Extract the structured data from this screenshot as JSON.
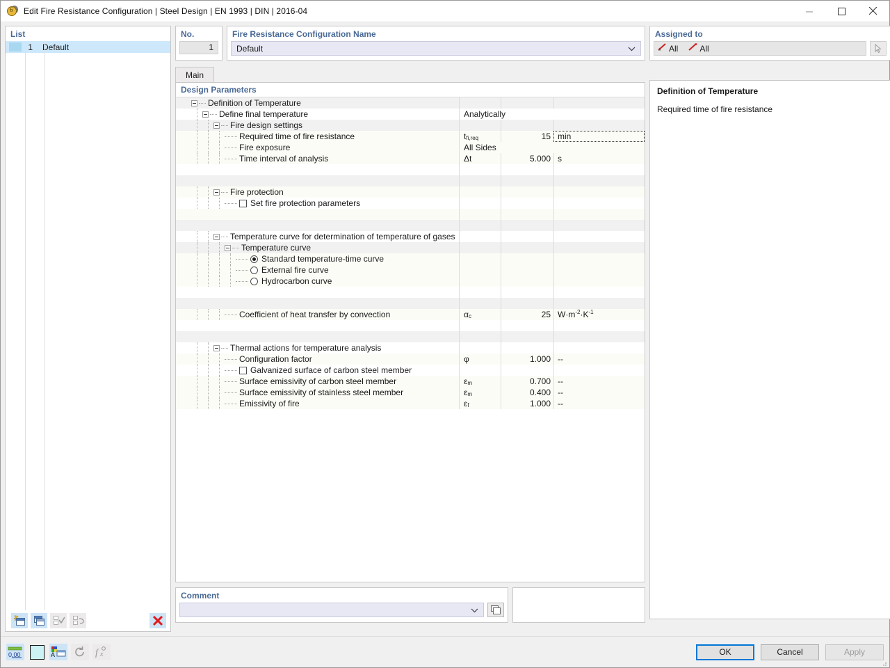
{
  "window": {
    "title": "Edit Fire Resistance Configuration | Steel Design | EN 1993 | DIN | 2016-04",
    "minimize_label": "Minimize",
    "maximize_label": "Maximize",
    "close_label": "Close"
  },
  "list_panel": {
    "title": "List",
    "rows": [
      {
        "no": "1",
        "name": "Default"
      }
    ],
    "toolbar": [
      {
        "name": "new-configuration-button",
        "label": "New"
      },
      {
        "name": "copy-configuration-button",
        "label": "Copy"
      },
      {
        "name": "select-all-button",
        "label": "Select All"
      },
      {
        "name": "deselect-button",
        "label": "Deselect"
      },
      {
        "name": "delete-configuration-button",
        "label": "Delete"
      }
    ]
  },
  "header": {
    "no_label": "No.",
    "no_value": "1",
    "name_label": "Fire Resistance Configuration Name",
    "name_value": "Default",
    "assigned_label": "Assigned to",
    "assigned_items": [
      "All",
      "All"
    ]
  },
  "tabs": [
    {
      "label": "Main",
      "active": true
    }
  ],
  "tree": {
    "section_title": "Design Parameters",
    "rows": [
      {
        "id": "definition-of-temperature",
        "kind": "group",
        "depth": 0,
        "label": "Definition of Temperature",
        "expander": true,
        "value": "",
        "symbol": "",
        "unit": "",
        "stripe": "grey"
      },
      {
        "id": "define-final-temperature",
        "kind": "group",
        "depth": 1,
        "label": "Define final temperature",
        "expander": true,
        "symbol": "",
        "value": "",
        "unit": "",
        "wide_value": "Analytically",
        "stripe": "a"
      },
      {
        "id": "fire-design-settings",
        "kind": "group",
        "depth": 2,
        "label": "Fire design settings",
        "expander": true,
        "symbol": "",
        "value": "",
        "unit": "",
        "stripe": "grey"
      },
      {
        "id": "required-time-of-fire-resistance",
        "kind": "field",
        "depth": 3,
        "label": "Required time of fire resistance",
        "symbol": "tfi,req",
        "value": "15",
        "unit": "min",
        "unit_focused": true,
        "stripe": "b"
      },
      {
        "id": "fire-exposure",
        "kind": "field",
        "depth": 3,
        "label": "Fire exposure",
        "symbol": "",
        "value": "",
        "unit": "",
        "wide_value": "All Sides",
        "stripe": "b"
      },
      {
        "id": "time-interval-of-analysis",
        "kind": "field",
        "depth": 3,
        "label": "Time interval of analysis",
        "symbol": "Δt",
        "value": "5.000",
        "unit": "s",
        "stripe": "b"
      },
      {
        "id": "spacer-1",
        "kind": "spacer",
        "depth": 0,
        "label": "",
        "stripe": "a"
      },
      {
        "id": "spacer-2",
        "kind": "spacer",
        "depth": 0,
        "label": "",
        "stripe": "grey"
      },
      {
        "id": "fire-protection",
        "kind": "group",
        "depth": 2,
        "label": "Fire protection",
        "expander": true,
        "symbol": "",
        "value": "",
        "unit": "",
        "stripe": "b"
      },
      {
        "id": "set-fire-protection-parameters",
        "kind": "checkbox",
        "depth": 3,
        "label": "Set fire protection parameters",
        "checked": false,
        "symbol": "",
        "value": "",
        "unit": "",
        "stripe": "a"
      },
      {
        "id": "spacer-3",
        "kind": "spacer",
        "depth": 0,
        "label": "",
        "stripe": "b"
      },
      {
        "id": "spacer-4",
        "kind": "spacer",
        "depth": 0,
        "label": "",
        "stripe": "grey"
      },
      {
        "id": "temperature-curve-for-gases",
        "kind": "group",
        "depth": 2,
        "label": "Temperature curve for determination of temperature of gases",
        "expander": true,
        "symbol": "",
        "value": "",
        "unit": "",
        "stripe": "a"
      },
      {
        "id": "temperature-curve",
        "kind": "group",
        "depth": 3,
        "label": "Temperature curve",
        "expander": true,
        "symbol": "",
        "value": "",
        "unit": "",
        "stripe": "grey"
      },
      {
        "id": "standard-temperature-time-curve",
        "kind": "radio",
        "depth": 4,
        "label": "Standard temperature-time curve",
        "checked": true,
        "symbol": "",
        "value": "",
        "unit": "",
        "stripe": "b"
      },
      {
        "id": "external-fire-curve",
        "kind": "radio",
        "depth": 4,
        "label": "External fire curve",
        "checked": false,
        "symbol": "",
        "value": "",
        "unit": "",
        "stripe": "b"
      },
      {
        "id": "hydrocarbon-curve",
        "kind": "radio",
        "depth": 4,
        "label": "Hydrocarbon curve",
        "checked": false,
        "symbol": "",
        "value": "",
        "unit": "",
        "stripe": "b"
      },
      {
        "id": "spacer-5",
        "kind": "spacer",
        "depth": 0,
        "label": "",
        "stripe": "a"
      },
      {
        "id": "spacer-6",
        "kind": "spacer",
        "depth": 0,
        "label": "",
        "stripe": "grey"
      },
      {
        "id": "coefficient-of-heat-transfer-by-convection",
        "kind": "field",
        "depth": 3,
        "label": "Coefficient of heat transfer by convection",
        "symbol": "αc",
        "value": "25",
        "unit": "W·m-2·K-1",
        "stripe": "b"
      },
      {
        "id": "spacer-7",
        "kind": "spacer",
        "depth": 0,
        "label": "",
        "stripe": "a"
      },
      {
        "id": "spacer-8",
        "kind": "spacer",
        "depth": 0,
        "label": "",
        "stripe": "grey"
      },
      {
        "id": "thermal-actions-for-temperature-analysis",
        "kind": "group",
        "depth": 2,
        "label": "Thermal actions for temperature analysis",
        "expander": true,
        "symbol": "",
        "value": "",
        "unit": "",
        "stripe": "a"
      },
      {
        "id": "configuration-factor",
        "kind": "field",
        "depth": 3,
        "label": "Configuration factor",
        "symbol": "φ",
        "value": "1.000",
        "unit": "--",
        "stripe": "b"
      },
      {
        "id": "galvanized-surface-of-carbon-steel-member",
        "kind": "checkbox",
        "depth": 3,
        "label": "Galvanized surface of carbon steel member",
        "checked": false,
        "symbol": "",
        "value": "",
        "unit": "",
        "stripe": "a"
      },
      {
        "id": "surface-emissivity-of-carbon-steel-member",
        "kind": "field",
        "depth": 3,
        "label": "Surface emissivity of carbon steel member",
        "symbol": "εm",
        "value": "0.700",
        "unit": "--",
        "stripe": "b"
      },
      {
        "id": "surface-emissivity-of-stainless-steel-member",
        "kind": "field",
        "depth": 3,
        "label": "Surface emissivity of stainless steel member",
        "symbol": "εm",
        "value": "0.400",
        "unit": "--",
        "stripe": "b"
      },
      {
        "id": "emissivity-of-fire",
        "kind": "field",
        "depth": 3,
        "label": "Emissivity of fire",
        "symbol": "εf",
        "value": "1.000",
        "unit": "--",
        "stripe": "b"
      }
    ]
  },
  "comment": {
    "label": "Comment",
    "value": "",
    "placeholder": ""
  },
  "info_panel": {
    "title": "Definition of Temperature",
    "text": "Required time of fire resistance"
  },
  "status_bar": {
    "buttons": [
      {
        "name": "decimal-places-button",
        "label": "0.00"
      },
      {
        "name": "color-swatch-button",
        "label": "Color"
      },
      {
        "name": "display-properties-button",
        "label": "Display Properties"
      },
      {
        "name": "reset-button",
        "label": "Reset"
      },
      {
        "name": "formula-button",
        "label": "Formula"
      }
    ]
  },
  "footer": {
    "ok_label": "OK",
    "cancel_label": "Cancel",
    "apply_label": "Apply"
  },
  "colors": {
    "accent_blue": "#0078d7",
    "header_text": "#4a6a96",
    "selection": "#cde8fb",
    "field_violet": "#e7e8f3",
    "delete_red": "#e01b1b"
  }
}
